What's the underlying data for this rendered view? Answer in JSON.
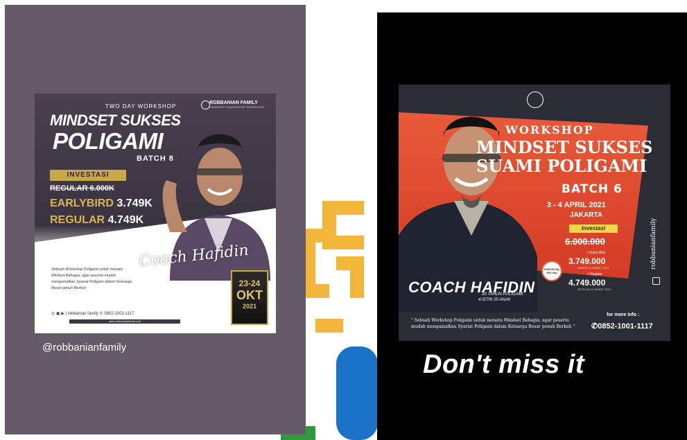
{
  "left": {
    "poster": {
      "eyebrow": "TWO DAY WORKSHOP",
      "title_line1": "MINDSET SUKSES",
      "title_line2": "POLIGAMI",
      "batch": "BATCH 8",
      "brand_name": "ROBBANIAN FAMILY",
      "brand_tagline": "HARMONY LEADERSHIP PARENTING",
      "invest_label": "INVESTASI",
      "regular_old": "REGULAR 6.000K",
      "earlybird_label": "EARLYBIRD",
      "earlybird_price": "3.749K",
      "regular_label": "REGULAR",
      "regular_price": "4.749K",
      "coach_signature": "Coach Hafidin",
      "description": "Sebuah Workshop Poligami untuk menata Mindset Bahagia, agar peserta mudah mengamalkan Syariat Poligami dalam Keluarga Besar penuh Berkah",
      "date_days": "23-24",
      "date_month": "OKT",
      "date_year": "2021",
      "footer_brand": "robbanian family",
      "footer_phone": "0852-1001-1117",
      "footer_url": "www.robbanianfamily.com"
    },
    "handle": "@robbanianfamily"
  },
  "right": {
    "poster": {
      "eyebrow": "WORKSHOP",
      "title_line1": "MINDSET SUKSES",
      "title_line2": "SUAMI POLIGAMI",
      "batch": "BATCH 6",
      "date": "3 - 4 APRIL 2021",
      "city": "JAKARTA",
      "invest_label": "Investasi",
      "old_price": "6.000.000",
      "earlybird_label": "> Early Bird",
      "earlybird_price": "3.749.000",
      "earlybird_note": "SAMPAI 21 MARET 2021",
      "regular_label": "> Reguler",
      "regular_price": "4.749.000",
      "regular_note": "SETELAH 21 MARET 2021",
      "discount_badge": "DISKON Rp. 500 ribu",
      "coach_name": "COACH HAFIDIN",
      "coach_years": "20 TAHUN POLIGAMI",
      "coach_family": "4 ISTRI 25 ANAK",
      "quote": "\" Sebuah Workshop Poligami untuk menata Mindset Bahagia, agar peserta mudah mengamalkan Syariat Poligami dalam Keluarga Besar penuh Berkah \"",
      "more_info": "for more info :",
      "phone": "0852-1001-1117",
      "side_brand": "robbanianfamily"
    },
    "caption": "Don't miss it"
  },
  "colors": {
    "left_bg": "#645a6a",
    "gold": "#c9a84a",
    "red": "#e85a3a",
    "right_bg": "#000000"
  },
  "icons": [
    "crown-logo-icon",
    "instagram-icon",
    "facebook-icon",
    "youtube-icon",
    "whatsapp-icon",
    "heart-logo-icon"
  ]
}
